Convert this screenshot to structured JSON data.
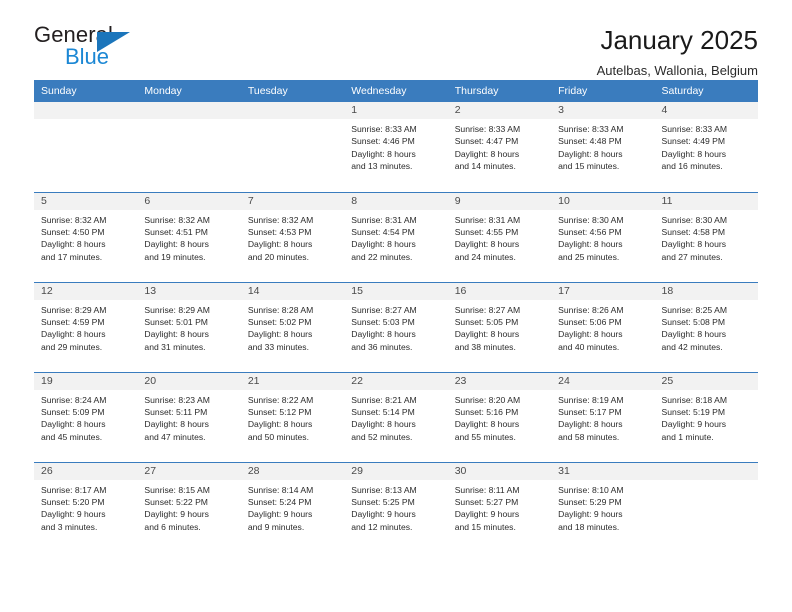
{
  "brand": {
    "name_top": "General",
    "name_bottom": "Blue",
    "accent_color": "#1b75bb"
  },
  "header": {
    "title": "January 2025",
    "subtitle": "Autelbas, Wallonia, Belgium"
  },
  "calendar": {
    "header_bg": "#3a7cbe",
    "daynum_bg": "#f2f2f2",
    "weekdays": [
      "Sunday",
      "Monday",
      "Tuesday",
      "Wednesday",
      "Thursday",
      "Friday",
      "Saturday"
    ],
    "weeks": [
      [
        {
          "empty": true
        },
        {
          "empty": true
        },
        {
          "empty": true
        },
        {
          "day": "1",
          "sunrise": "Sunrise: 8:33 AM",
          "sunset": "Sunset: 4:46 PM",
          "daylight_1": "Daylight: 8 hours",
          "daylight_2": "and 13 minutes."
        },
        {
          "day": "2",
          "sunrise": "Sunrise: 8:33 AM",
          "sunset": "Sunset: 4:47 PM",
          "daylight_1": "Daylight: 8 hours",
          "daylight_2": "and 14 minutes."
        },
        {
          "day": "3",
          "sunrise": "Sunrise: 8:33 AM",
          "sunset": "Sunset: 4:48 PM",
          "daylight_1": "Daylight: 8 hours",
          "daylight_2": "and 15 minutes."
        },
        {
          "day": "4",
          "sunrise": "Sunrise: 8:33 AM",
          "sunset": "Sunset: 4:49 PM",
          "daylight_1": "Daylight: 8 hours",
          "daylight_2": "and 16 minutes."
        }
      ],
      [
        {
          "day": "5",
          "sunrise": "Sunrise: 8:32 AM",
          "sunset": "Sunset: 4:50 PM",
          "daylight_1": "Daylight: 8 hours",
          "daylight_2": "and 17 minutes."
        },
        {
          "day": "6",
          "sunrise": "Sunrise: 8:32 AM",
          "sunset": "Sunset: 4:51 PM",
          "daylight_1": "Daylight: 8 hours",
          "daylight_2": "and 19 minutes."
        },
        {
          "day": "7",
          "sunrise": "Sunrise: 8:32 AM",
          "sunset": "Sunset: 4:53 PM",
          "daylight_1": "Daylight: 8 hours",
          "daylight_2": "and 20 minutes."
        },
        {
          "day": "8",
          "sunrise": "Sunrise: 8:31 AM",
          "sunset": "Sunset: 4:54 PM",
          "daylight_1": "Daylight: 8 hours",
          "daylight_2": "and 22 minutes."
        },
        {
          "day": "9",
          "sunrise": "Sunrise: 8:31 AM",
          "sunset": "Sunset: 4:55 PM",
          "daylight_1": "Daylight: 8 hours",
          "daylight_2": "and 24 minutes."
        },
        {
          "day": "10",
          "sunrise": "Sunrise: 8:30 AM",
          "sunset": "Sunset: 4:56 PM",
          "daylight_1": "Daylight: 8 hours",
          "daylight_2": "and 25 minutes."
        },
        {
          "day": "11",
          "sunrise": "Sunrise: 8:30 AM",
          "sunset": "Sunset: 4:58 PM",
          "daylight_1": "Daylight: 8 hours",
          "daylight_2": "and 27 minutes."
        }
      ],
      [
        {
          "day": "12",
          "sunrise": "Sunrise: 8:29 AM",
          "sunset": "Sunset: 4:59 PM",
          "daylight_1": "Daylight: 8 hours",
          "daylight_2": "and 29 minutes."
        },
        {
          "day": "13",
          "sunrise": "Sunrise: 8:29 AM",
          "sunset": "Sunset: 5:01 PM",
          "daylight_1": "Daylight: 8 hours",
          "daylight_2": "and 31 minutes."
        },
        {
          "day": "14",
          "sunrise": "Sunrise: 8:28 AM",
          "sunset": "Sunset: 5:02 PM",
          "daylight_1": "Daylight: 8 hours",
          "daylight_2": "and 33 minutes."
        },
        {
          "day": "15",
          "sunrise": "Sunrise: 8:27 AM",
          "sunset": "Sunset: 5:03 PM",
          "daylight_1": "Daylight: 8 hours",
          "daylight_2": "and 36 minutes."
        },
        {
          "day": "16",
          "sunrise": "Sunrise: 8:27 AM",
          "sunset": "Sunset: 5:05 PM",
          "daylight_1": "Daylight: 8 hours",
          "daylight_2": "and 38 minutes."
        },
        {
          "day": "17",
          "sunrise": "Sunrise: 8:26 AM",
          "sunset": "Sunset: 5:06 PM",
          "daylight_1": "Daylight: 8 hours",
          "daylight_2": "and 40 minutes."
        },
        {
          "day": "18",
          "sunrise": "Sunrise: 8:25 AM",
          "sunset": "Sunset: 5:08 PM",
          "daylight_1": "Daylight: 8 hours",
          "daylight_2": "and 42 minutes."
        }
      ],
      [
        {
          "day": "19",
          "sunrise": "Sunrise: 8:24 AM",
          "sunset": "Sunset: 5:09 PM",
          "daylight_1": "Daylight: 8 hours",
          "daylight_2": "and 45 minutes."
        },
        {
          "day": "20",
          "sunrise": "Sunrise: 8:23 AM",
          "sunset": "Sunset: 5:11 PM",
          "daylight_1": "Daylight: 8 hours",
          "daylight_2": "and 47 minutes."
        },
        {
          "day": "21",
          "sunrise": "Sunrise: 8:22 AM",
          "sunset": "Sunset: 5:12 PM",
          "daylight_1": "Daylight: 8 hours",
          "daylight_2": "and 50 minutes."
        },
        {
          "day": "22",
          "sunrise": "Sunrise: 8:21 AM",
          "sunset": "Sunset: 5:14 PM",
          "daylight_1": "Daylight: 8 hours",
          "daylight_2": "and 52 minutes."
        },
        {
          "day": "23",
          "sunrise": "Sunrise: 8:20 AM",
          "sunset": "Sunset: 5:16 PM",
          "daylight_1": "Daylight: 8 hours",
          "daylight_2": "and 55 minutes."
        },
        {
          "day": "24",
          "sunrise": "Sunrise: 8:19 AM",
          "sunset": "Sunset: 5:17 PM",
          "daylight_1": "Daylight: 8 hours",
          "daylight_2": "and 58 minutes."
        },
        {
          "day": "25",
          "sunrise": "Sunrise: 8:18 AM",
          "sunset": "Sunset: 5:19 PM",
          "daylight_1": "Daylight: 9 hours",
          "daylight_2": "and 1 minute."
        }
      ],
      [
        {
          "day": "26",
          "sunrise": "Sunrise: 8:17 AM",
          "sunset": "Sunset: 5:20 PM",
          "daylight_1": "Daylight: 9 hours",
          "daylight_2": "and 3 minutes."
        },
        {
          "day": "27",
          "sunrise": "Sunrise: 8:15 AM",
          "sunset": "Sunset: 5:22 PM",
          "daylight_1": "Daylight: 9 hours",
          "daylight_2": "and 6 minutes."
        },
        {
          "day": "28",
          "sunrise": "Sunrise: 8:14 AM",
          "sunset": "Sunset: 5:24 PM",
          "daylight_1": "Daylight: 9 hours",
          "daylight_2": "and 9 minutes."
        },
        {
          "day": "29",
          "sunrise": "Sunrise: 8:13 AM",
          "sunset": "Sunset: 5:25 PM",
          "daylight_1": "Daylight: 9 hours",
          "daylight_2": "and 12 minutes."
        },
        {
          "day": "30",
          "sunrise": "Sunrise: 8:11 AM",
          "sunset": "Sunset: 5:27 PM",
          "daylight_1": "Daylight: 9 hours",
          "daylight_2": "and 15 minutes."
        },
        {
          "day": "31",
          "sunrise": "Sunrise: 8:10 AM",
          "sunset": "Sunset: 5:29 PM",
          "daylight_1": "Daylight: 9 hours",
          "daylight_2": "and 18 minutes."
        },
        {
          "empty": true
        }
      ]
    ]
  }
}
